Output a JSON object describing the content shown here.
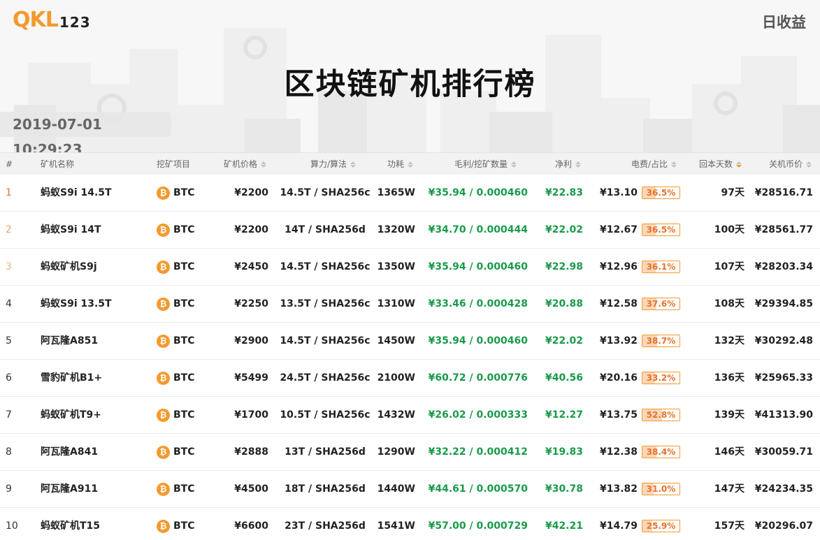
{
  "header": {
    "logo_text": "QKL",
    "logo_num": "123",
    "daily_label": "日收益",
    "title": "区块链矿机排行榜",
    "timestamp": "2019-07-01 10:29:23"
  },
  "columns": {
    "rank": "#",
    "name": "矿机名称",
    "coin": "挖矿项目",
    "price": "矿机价格",
    "hash": "算力/算法",
    "power": "功耗",
    "profit": "毛利/挖矿数量",
    "net": "净利",
    "elec": "电费/占比",
    "days": "回本天数",
    "shutdown": "关机币价"
  },
  "colors": {
    "accent": "#f29a2e",
    "profit_green": "#1a9a4a"
  },
  "rows": [
    {
      "rank": "1",
      "name": "蚂蚁S9i 14.5T",
      "coin": "BTC",
      "price": "¥2200",
      "hash": "14.5T / SHA256c",
      "power": "1365W",
      "profit": "¥35.94 / 0.000460",
      "net": "¥22.83",
      "elec": "¥13.10",
      "ratio": "36.5%",
      "ratio_value": 36.5,
      "days": "97天",
      "shutdown": "¥28516.71"
    },
    {
      "rank": "2",
      "name": "蚂蚁S9i 14T",
      "coin": "BTC",
      "price": "¥2200",
      "hash": "14T / SHA256d",
      "power": "1320W",
      "profit": "¥34.70 / 0.000444",
      "net": "¥22.02",
      "elec": "¥12.67",
      "ratio": "36.5%",
      "ratio_value": 36.5,
      "days": "100天",
      "shutdown": "¥28561.77"
    },
    {
      "rank": "3",
      "name": "蚂蚁矿机S9j",
      "coin": "BTC",
      "price": "¥2450",
      "hash": "14.5T / SHA256c",
      "power": "1350W",
      "profit": "¥35.94 / 0.000460",
      "net": "¥22.98",
      "elec": "¥12.96",
      "ratio": "36.1%",
      "ratio_value": 36.1,
      "days": "107天",
      "shutdown": "¥28203.34"
    },
    {
      "rank": "4",
      "name": "蚂蚁S9i 13.5T",
      "coin": "BTC",
      "price": "¥2250",
      "hash": "13.5T / SHA256c",
      "power": "1310W",
      "profit": "¥33.46 / 0.000428",
      "net": "¥20.88",
      "elec": "¥12.58",
      "ratio": "37.6%",
      "ratio_value": 37.6,
      "days": "108天",
      "shutdown": "¥29394.85"
    },
    {
      "rank": "5",
      "name": "阿瓦隆A851",
      "coin": "BTC",
      "price": "¥2900",
      "hash": "14.5T / SHA256c",
      "power": "1450W",
      "profit": "¥35.94 / 0.000460",
      "net": "¥22.02",
      "elec": "¥13.92",
      "ratio": "38.7%",
      "ratio_value": 38.7,
      "days": "132天",
      "shutdown": "¥30292.48"
    },
    {
      "rank": "6",
      "name": "雪豹矿机B1+",
      "coin": "BTC",
      "price": "¥5499",
      "hash": "24.5T / SHA256c",
      "power": "2100W",
      "profit": "¥60.72 / 0.000776",
      "net": "¥40.56",
      "elec": "¥20.16",
      "ratio": "33.2%",
      "ratio_value": 33.2,
      "days": "136天",
      "shutdown": "¥25965.33"
    },
    {
      "rank": "7",
      "name": "蚂蚁矿机T9+",
      "coin": "BTC",
      "price": "¥1700",
      "hash": "10.5T / SHA256c",
      "power": "1432W",
      "profit": "¥26.02 / 0.000333",
      "net": "¥12.27",
      "elec": "¥13.75",
      "ratio": "52.8%",
      "ratio_value": 52.8,
      "days": "139天",
      "shutdown": "¥41313.90"
    },
    {
      "rank": "8",
      "name": "阿瓦隆A841",
      "coin": "BTC",
      "price": "¥2888",
      "hash": "13T / SHA256d",
      "power": "1290W",
      "profit": "¥32.22 / 0.000412",
      "net": "¥19.83",
      "elec": "¥12.38",
      "ratio": "38.4%",
      "ratio_value": 38.4,
      "days": "146天",
      "shutdown": "¥30059.71"
    },
    {
      "rank": "9",
      "name": "阿瓦隆A911",
      "coin": "BTC",
      "price": "¥4500",
      "hash": "18T / SHA256d",
      "power": "1440W",
      "profit": "¥44.61 / 0.000570",
      "net": "¥30.78",
      "elec": "¥13.82",
      "ratio": "31.0%",
      "ratio_value": 31.0,
      "days": "147天",
      "shutdown": "¥24234.35"
    },
    {
      "rank": "10",
      "name": "蚂蚁矿机T15",
      "coin": "BTC",
      "price": "¥6600",
      "hash": "23T / SHA256d",
      "power": "1541W",
      "profit": "¥57.00 / 0.000729",
      "net": "¥42.21",
      "elec": "¥14.79",
      "ratio": "25.9%",
      "ratio_value": 25.9,
      "days": "157天",
      "shutdown": "¥20296.07"
    }
  ]
}
